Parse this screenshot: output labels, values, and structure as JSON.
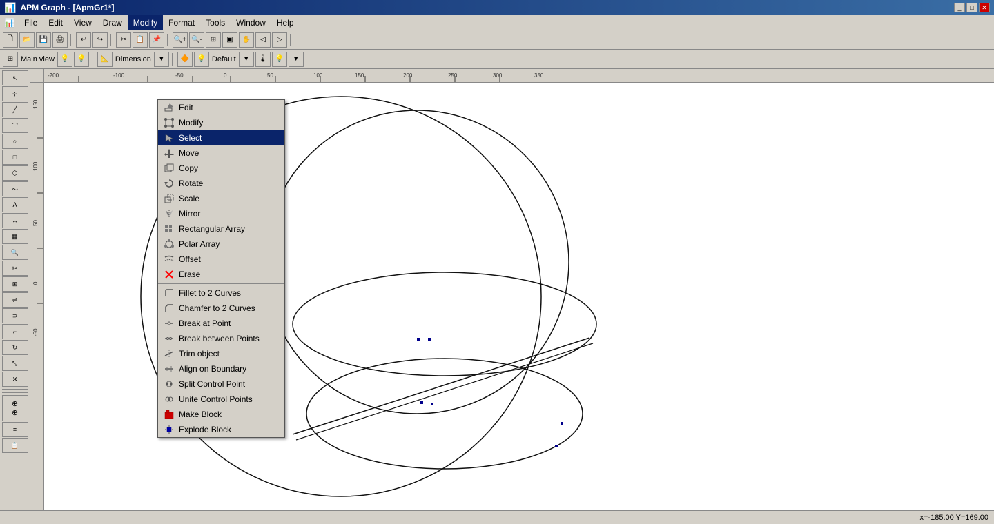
{
  "titlebar": {
    "title": "APM Graph - [ApmGr1*]",
    "controls": [
      "_",
      "□",
      "✕"
    ]
  },
  "menubar": {
    "items": [
      {
        "label": "",
        "name": "app-icon"
      },
      {
        "label": "File",
        "name": "file-menu"
      },
      {
        "label": "Edit",
        "name": "edit-menu"
      },
      {
        "label": "View",
        "name": "view-menu"
      },
      {
        "label": "Draw",
        "name": "draw-menu"
      },
      {
        "label": "Modify",
        "name": "modify-menu",
        "active": true
      },
      {
        "label": "Format",
        "name": "format-menu"
      },
      {
        "label": "Tools",
        "name": "tools-menu"
      },
      {
        "label": "Window",
        "name": "window-menu"
      },
      {
        "label": "Help",
        "name": "help-menu"
      }
    ]
  },
  "modify_menu": {
    "items": [
      {
        "label": "Edit",
        "icon": "edit-icon",
        "separator_after": false
      },
      {
        "label": "Modify",
        "icon": "modify-icon",
        "separator_after": false
      },
      {
        "label": "Select",
        "icon": "select-icon",
        "highlighted": true,
        "separator_after": false
      },
      {
        "label": "Move",
        "icon": "move-icon",
        "separator_after": false
      },
      {
        "label": "Copy",
        "icon": "copy-icon",
        "separator_after": false
      },
      {
        "label": "Rotate",
        "icon": "rotate-icon",
        "separator_after": false
      },
      {
        "label": "Scale",
        "icon": "scale-icon",
        "separator_after": false
      },
      {
        "label": "Mirror",
        "icon": "mirror-icon",
        "separator_after": false
      },
      {
        "label": "Rectangular Array",
        "icon": "rect-array-icon",
        "separator_after": false
      },
      {
        "label": "Polar Array",
        "icon": "polar-array-icon",
        "separator_after": false
      },
      {
        "label": "Offset",
        "icon": "offset-icon",
        "separator_after": false
      },
      {
        "label": "Erase",
        "icon": "erase-icon",
        "separator_after": true
      },
      {
        "label": "Fillet to 2 Curves",
        "icon": "fillet-icon",
        "separator_after": false
      },
      {
        "label": "Chamfer to 2 Curves",
        "icon": "chamfer-icon",
        "separator_after": false
      },
      {
        "label": "Break at Point",
        "icon": "break-point-icon",
        "separator_after": false
      },
      {
        "label": "Break between Points",
        "icon": "break-between-icon",
        "separator_after": false
      },
      {
        "label": "Trim object",
        "icon": "trim-icon",
        "separator_after": false
      },
      {
        "label": "Align on Boundary",
        "icon": "align-icon",
        "separator_after": false
      },
      {
        "label": "Split Control Point",
        "icon": "split-icon",
        "separator_after": false
      },
      {
        "label": "Unite Control Points",
        "icon": "unite-icon",
        "separator_after": false
      },
      {
        "label": "Make Block",
        "icon": "make-block-icon",
        "separator_after": false
      },
      {
        "label": "Explode Block",
        "icon": "explode-icon",
        "separator_after": false
      }
    ]
  },
  "toolbar2": {
    "view_label": "Main view",
    "dimension_label": "Dimension",
    "default_label": "Default"
  },
  "ruler": {
    "h_ticks": [
      -200,
      -100,
      -50,
      0,
      50,
      100,
      150,
      200,
      250,
      300,
      350
    ],
    "v_ticks": [
      150,
      100,
      50,
      0,
      -50
    ]
  },
  "statusbar": {
    "coords": "x=-185.00 Y=169.00"
  }
}
